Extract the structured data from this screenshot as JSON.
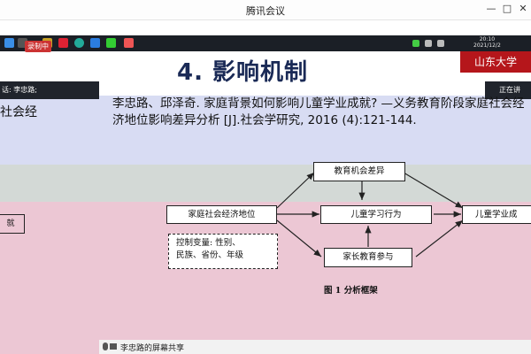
{
  "window": {
    "title": "腾讯会议",
    "min": "—",
    "max": "□",
    "close": "✕"
  },
  "taskbar": {
    "time": "20:10",
    "date": "2021/12/2"
  },
  "meeting": {
    "recording": "录制中",
    "speaker_left": "话: 李忠路;",
    "speaker_right": "正在讲",
    "share_text": "李忠路的屏幕共享"
  },
  "slide": {
    "title": "4. 影响机制",
    "logo_text": "山东大学",
    "reference": "李忠路、邱泽奇. 家庭背景如何影响儿童学业成就? —义务教育阶段家庭社会经济地位影响差异分析 [J].社会学研究, 2016 (4):121-144.",
    "left_text": "社会经",
    "left_box": "就",
    "diagram": {
      "ses": "家庭社会经济地位",
      "opportunity": "教育机会差异",
      "learning": "儿童学习行为",
      "parental": "家长教育参与",
      "outcome": "儿童学业成",
      "controls_line1": "控制变量: 性别、",
      "controls_line2": "民族、省份、年级",
      "caption": "图 1  分析框架"
    }
  },
  "colors": {
    "band_blue": "#d8dcf3",
    "band_gray": "#d3d9d6",
    "band_pink": "#ecc7d4",
    "title": "#1a2a56",
    "logo": "#b5161b"
  }
}
